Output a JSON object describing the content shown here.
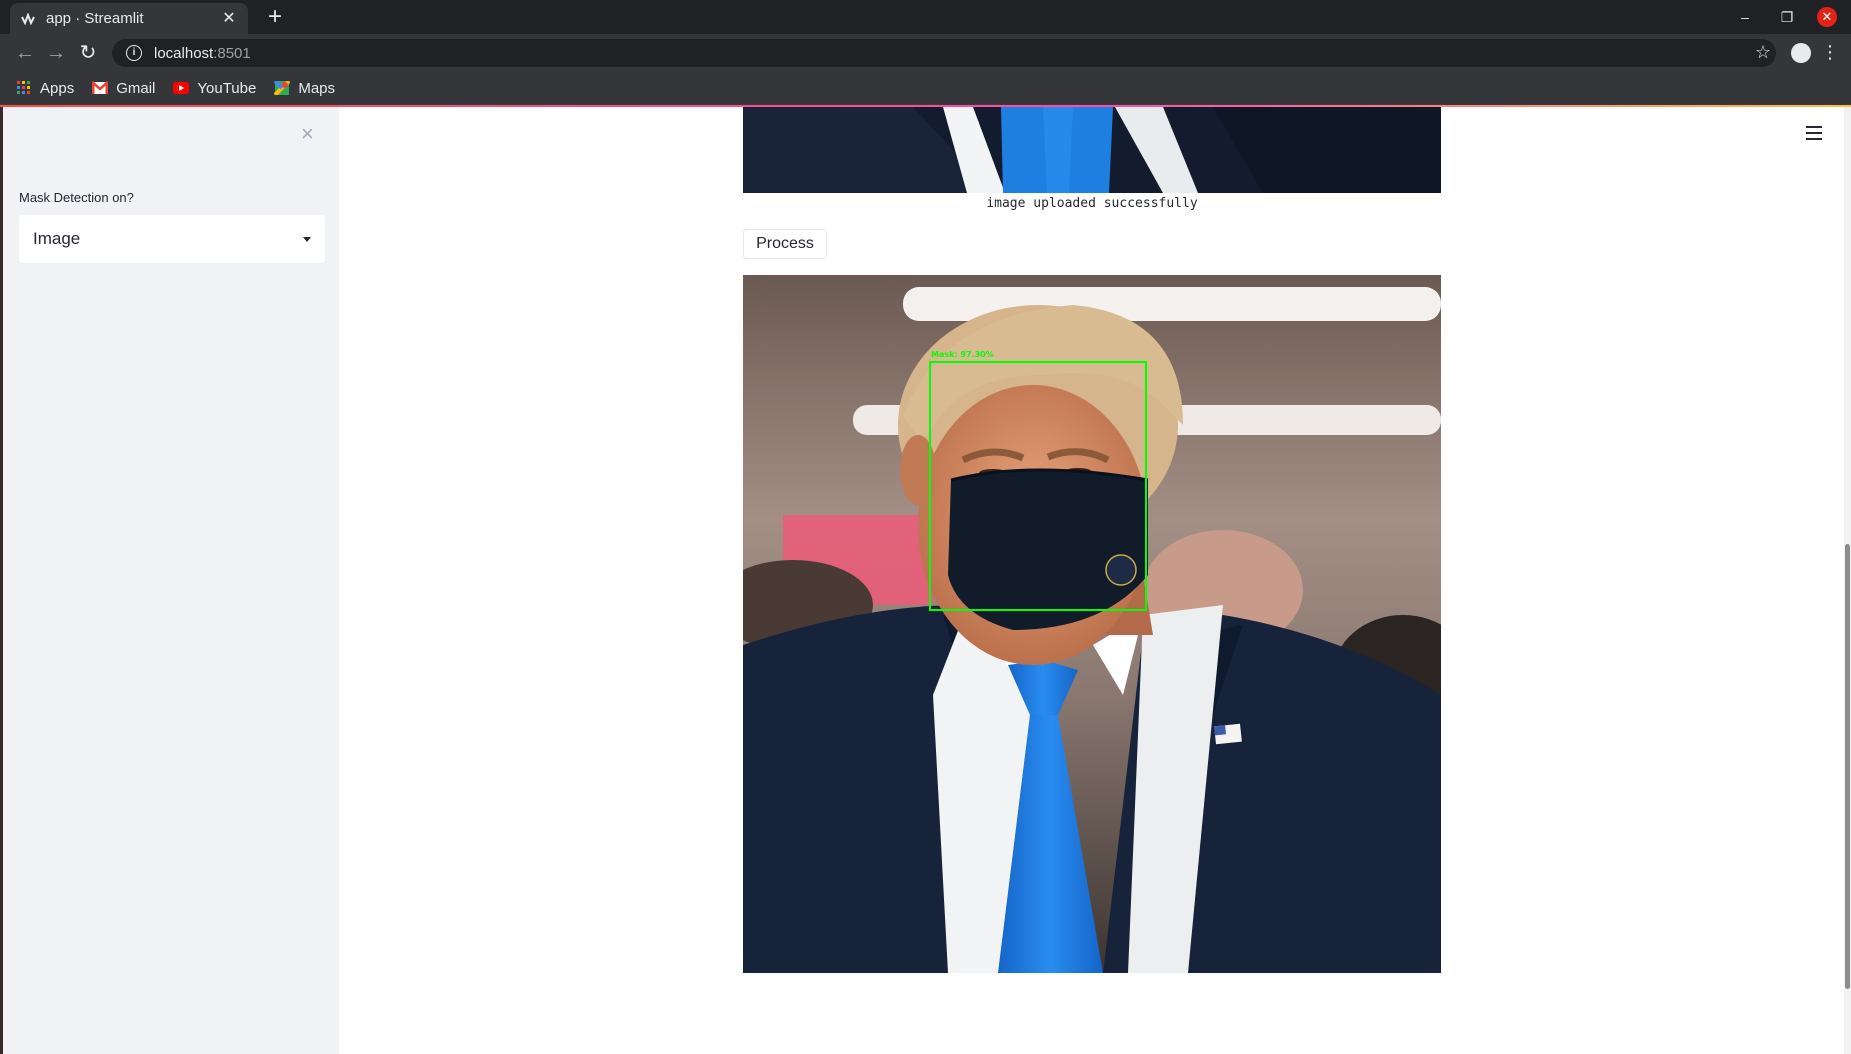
{
  "browser": {
    "tab_title": "app · Streamlit",
    "new_tab_icon": "+",
    "url_host": "localhost",
    "url_port": ":8501",
    "bookmarks": [
      {
        "label": "Apps",
        "icon": "apps-grid-icon"
      },
      {
        "label": "Gmail",
        "icon": "gmail-icon"
      },
      {
        "label": "YouTube",
        "icon": "youtube-icon"
      },
      {
        "label": "Maps",
        "icon": "maps-icon"
      }
    ]
  },
  "sidebar": {
    "close_icon": "×",
    "label": "Mask Detection on?",
    "select_value": "Image"
  },
  "main": {
    "caption": "image uploaded successfully",
    "process_label": "Process",
    "detection_label": "Mask: 97.30%"
  },
  "colors": {
    "accent": "#ff4b4b",
    "detection_box": "#00ff00",
    "tie": "#1e7be0",
    "suit": "#17233a"
  }
}
